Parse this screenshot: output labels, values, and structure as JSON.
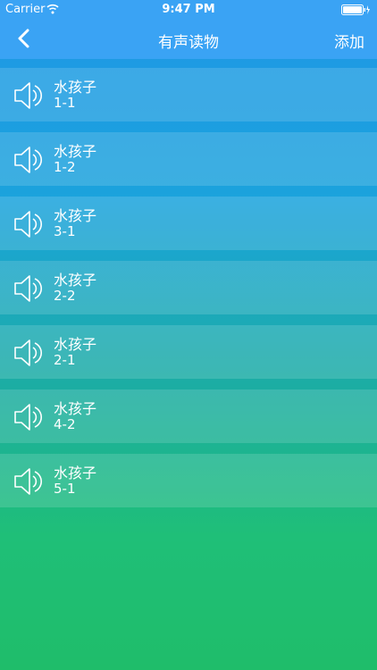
{
  "status_bar": {
    "carrier": "Carrier",
    "time": "9:47 PM"
  },
  "nav": {
    "title": "有声读物",
    "add_label": "添加"
  },
  "items": [
    {
      "title": "水孩子",
      "subtitle": "1-1"
    },
    {
      "title": "水孩子",
      "subtitle": "1-2"
    },
    {
      "title": "水孩子",
      "subtitle": "3-1"
    },
    {
      "title": "水孩子",
      "subtitle": "2-2"
    },
    {
      "title": "水孩子",
      "subtitle": "2-1"
    },
    {
      "title": "水孩子",
      "subtitle": "4-2"
    },
    {
      "title": "水孩子",
      "subtitle": "5-1"
    }
  ],
  "icons": {
    "back": "chevron-left-icon",
    "speaker": "speaker-icon",
    "wifi": "wifi-icon",
    "battery": "battery-icon"
  }
}
